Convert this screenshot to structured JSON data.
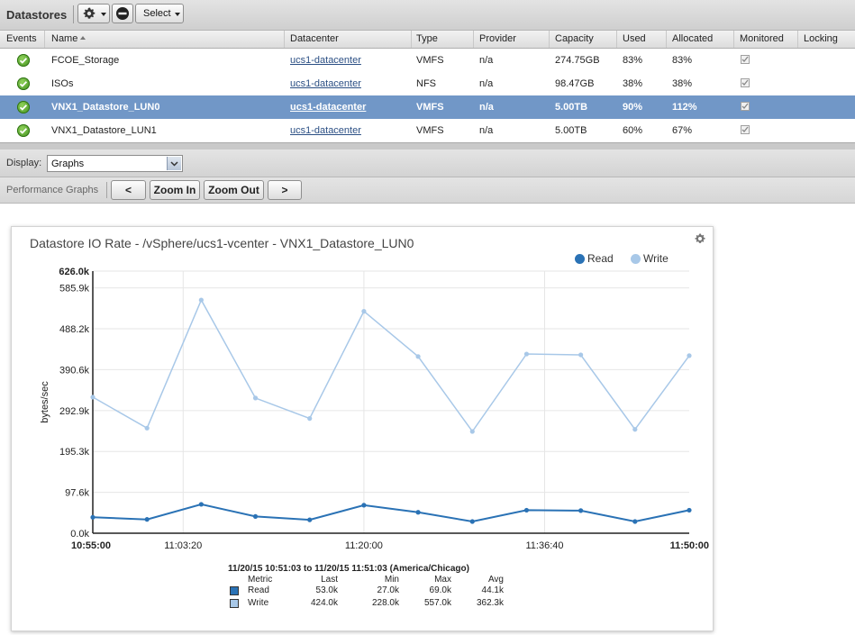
{
  "toolbar": {
    "title": "Datastores",
    "select_label": "Select"
  },
  "columns": [
    "Events",
    "Name",
    "Datacenter",
    "Type",
    "Provider",
    "Capacity",
    "Used",
    "Allocated",
    "Monitored",
    "Locking"
  ],
  "rows": [
    {
      "name": "FCOE_Storage",
      "datacenter": "ucs1-datacenter",
      "type": "VMFS",
      "provider": "n/a",
      "capacity": "274.75GB",
      "used": "83%",
      "allocated": "83%",
      "selected": false
    },
    {
      "name": "ISOs",
      "datacenter": "ucs1-datacenter",
      "type": "NFS",
      "provider": "n/a",
      "capacity": "98.47GB",
      "used": "38%",
      "allocated": "38%",
      "selected": false
    },
    {
      "name": "VNX1_Datastore_LUN0",
      "datacenter": "ucs1-datacenter",
      "type": "VMFS",
      "provider": "n/a",
      "capacity": "5.00TB",
      "used": "90%",
      "allocated": "112%",
      "selected": true
    },
    {
      "name": "VNX1_Datastore_LUN1",
      "datacenter": "ucs1-datacenter",
      "type": "VMFS",
      "provider": "n/a",
      "capacity": "5.00TB",
      "used": "60%",
      "allocated": "67%",
      "selected": false
    }
  ],
  "display": {
    "label": "Display:",
    "value": "Graphs"
  },
  "perf": {
    "label": "Performance Graphs",
    "prev": "<",
    "zoom_in": "Zoom In",
    "zoom_out": "Zoom Out",
    "next": ">"
  },
  "colors": {
    "read": "#2a72b5",
    "write": "#a8c8e8",
    "selected_row": "#7197c7"
  },
  "chart_data": {
    "type": "line",
    "title": "Datastore IO Rate - /vSphere/ucs1-vcenter - VNX1_Datastore_LUN0",
    "ylabel": "bytes/sec",
    "ylim": [
      0,
      626000
    ],
    "y_ticks": [
      "0.0k",
      "97.6k",
      "195.3k",
      "292.9k",
      "390.6k",
      "488.2k",
      "585.9k",
      "626.0k"
    ],
    "x_ticks": [
      "10:55:00",
      "11:03:20",
      "11:20:00",
      "11:36:40",
      "11:50:00"
    ],
    "legend_position": "top-right",
    "grid": true,
    "series": [
      {
        "name": "Read",
        "color": "#2a72b5",
        "x": [
          "10:55:00",
          "11:00:00",
          "11:05:00",
          "11:10:00",
          "11:15:00",
          "11:20:00",
          "11:25:00",
          "11:30:00",
          "11:35:00",
          "11:40:00",
          "11:45:00",
          "11:50:00"
        ],
        "values": [
          38000,
          33000,
          69000,
          40000,
          32000,
          67000,
          50000,
          28000,
          55000,
          54000,
          28000,
          55000
        ]
      },
      {
        "name": "Write",
        "color": "#a8c8e8",
        "x": [
          "10:55:00",
          "11:00:00",
          "11:05:00",
          "11:10:00",
          "11:15:00",
          "11:20:00",
          "11:25:00",
          "11:30:00",
          "11:35:00",
          "11:40:00",
          "11:45:00",
          "11:50:00"
        ],
        "values": [
          325000,
          251000,
          557000,
          323000,
          274000,
          530000,
          422000,
          243000,
          428000,
          426000,
          248000,
          424000
        ]
      }
    ],
    "summary": {
      "title": "11/20/15 10:51:03 to 11/20/15 11:51:03 (America/Chicago)",
      "headers": [
        "Metric",
        "Last",
        "Min",
        "Max",
        "Avg"
      ],
      "rows": [
        {
          "metric": "Read",
          "last": "53.0k",
          "min": "27.0k",
          "max": "69.0k",
          "avg": "44.1k"
        },
        {
          "metric": "Write",
          "last": "424.0k",
          "min": "228.0k",
          "max": "557.0k",
          "avg": "362.3k"
        }
      ]
    }
  }
}
